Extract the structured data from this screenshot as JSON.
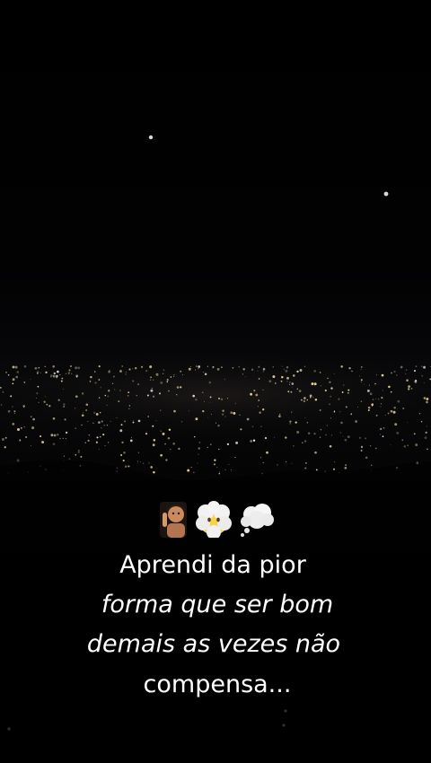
{
  "scene": {
    "description_icons": [
      "night-sky",
      "city-lights"
    ]
  },
  "emojis": [
    {
      "name": "shushing-person-emoji"
    },
    {
      "name": "face-in-clouds-emoji"
    },
    {
      "name": "thought-balloon-emoji"
    }
  ],
  "caption": {
    "line1": "Aprendi da pior",
    "line2": "forma que ser bom",
    "line3": "demais as vezes não",
    "line4": "compensa..."
  },
  "colors": {
    "background": "#000000",
    "caption_text": "#ffffff",
    "city_light": "#f3d9a0"
  }
}
